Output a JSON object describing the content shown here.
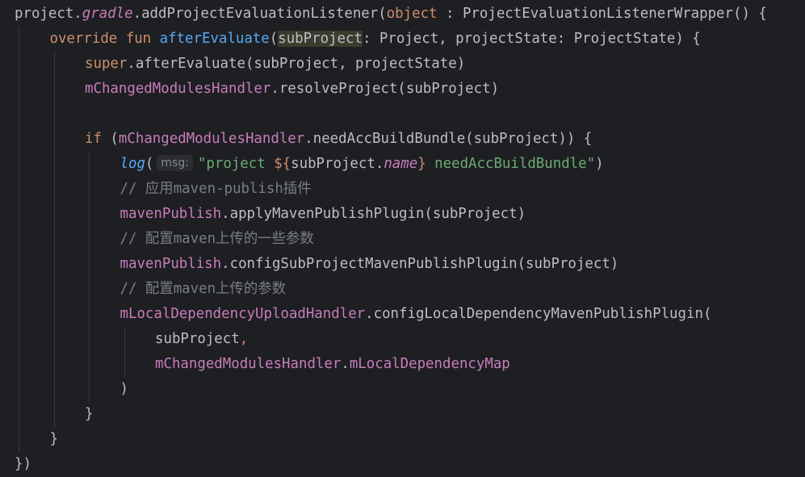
{
  "editor": {
    "language": "kotlin",
    "background": "#1e1f22",
    "lines": [
      {
        "indent": 0,
        "tokens": [
          {
            "t": "project.",
            "c": "plain"
          },
          {
            "t": "gradle",
            "c": "ext"
          },
          {
            "t": ".addProjectEvaluationListener(",
            "c": "plain"
          },
          {
            "t": "object",
            "c": "kw"
          },
          {
            "t": " : ProjectEvaluationListenerWrapper() {",
            "c": "plain"
          }
        ]
      },
      {
        "indent": 1,
        "tokens": [
          {
            "t": "override fun ",
            "c": "kw"
          },
          {
            "t": "afterEvaluate",
            "c": "fndecl"
          },
          {
            "t": "(",
            "c": "plain"
          },
          {
            "t": "subProject",
            "c": "plain",
            "hl": true
          },
          {
            "t": ": Project, projectState: ProjectState) {",
            "c": "plain"
          }
        ]
      },
      {
        "indent": 2,
        "tokens": [
          {
            "t": "super",
            "c": "kw"
          },
          {
            "t": ".afterEvaluate(subProject, projectState)",
            "c": "plain"
          }
        ]
      },
      {
        "indent": 2,
        "tokens": [
          {
            "t": "mChangedModulesHandler",
            "c": "prop"
          },
          {
            "t": ".resolveProject(subProject)",
            "c": "plain"
          }
        ]
      },
      {
        "indent": 0,
        "tokens": []
      },
      {
        "indent": 2,
        "tokens": [
          {
            "t": "if ",
            "c": "kw"
          },
          {
            "t": "(",
            "c": "plain"
          },
          {
            "t": "mChangedModulesHandler",
            "c": "prop"
          },
          {
            "t": ".needAccBuildBundle(subProject)) {",
            "c": "plain"
          }
        ]
      },
      {
        "indent": 3,
        "tokens": [
          {
            "t": "log",
            "c": "topfn"
          },
          {
            "t": "(",
            "c": "plain"
          },
          {
            "hint": "msg:"
          },
          {
            "t": "\"project ",
            "c": "str"
          },
          {
            "t": "${",
            "c": "kw"
          },
          {
            "t": "subProject.",
            "c": "plain"
          },
          {
            "t": "name",
            "c": "ext"
          },
          {
            "t": "}",
            "c": "kw"
          },
          {
            "t": " needAccBuildBundle\"",
            "c": "str"
          },
          {
            "t": ")",
            "c": "plain"
          }
        ]
      },
      {
        "indent": 3,
        "tokens": [
          {
            "t": "// 应用maven-publish插件",
            "c": "cmt"
          }
        ]
      },
      {
        "indent": 3,
        "tokens": [
          {
            "t": "mavenPublish",
            "c": "prop"
          },
          {
            "t": ".applyMavenPublishPlugin(subProject)",
            "c": "plain"
          }
        ]
      },
      {
        "indent": 3,
        "tokens": [
          {
            "t": "// 配置maven上传的一些参数",
            "c": "cmt"
          }
        ]
      },
      {
        "indent": 3,
        "tokens": [
          {
            "t": "mavenPublish",
            "c": "prop"
          },
          {
            "t": ".configSubProjectMavenPublishPlugin(subProject)",
            "c": "plain"
          }
        ]
      },
      {
        "indent": 3,
        "tokens": [
          {
            "t": "// 配置maven上传的参数",
            "c": "cmt"
          }
        ]
      },
      {
        "indent": 3,
        "tokens": [
          {
            "t": "mLocalDependencyUploadHandler",
            "c": "prop"
          },
          {
            "t": ".configLocalDependencyMavenPublishPlugin(",
            "c": "plain"
          }
        ]
      },
      {
        "indent": 4,
        "tokens": [
          {
            "t": "subProject",
            "c": "plain"
          },
          {
            "t": ",",
            "c": "kw"
          }
        ]
      },
      {
        "indent": 4,
        "tokens": [
          {
            "t": "mChangedModulesHandler",
            "c": "prop"
          },
          {
            "t": ".",
            "c": "plain"
          },
          {
            "t": "mLocalDependencyMap",
            "c": "prop"
          }
        ]
      },
      {
        "indent": 3,
        "tokens": [
          {
            "t": ")",
            "c": "plain"
          }
        ]
      },
      {
        "indent": 2,
        "tokens": [
          {
            "t": "}",
            "c": "plain"
          }
        ]
      },
      {
        "indent": 1,
        "tokens": [
          {
            "t": "}",
            "c": "plain"
          }
        ]
      },
      {
        "indent": 0,
        "tokens": [
          {
            "t": "})",
            "c": "plain"
          }
        ]
      }
    ]
  }
}
